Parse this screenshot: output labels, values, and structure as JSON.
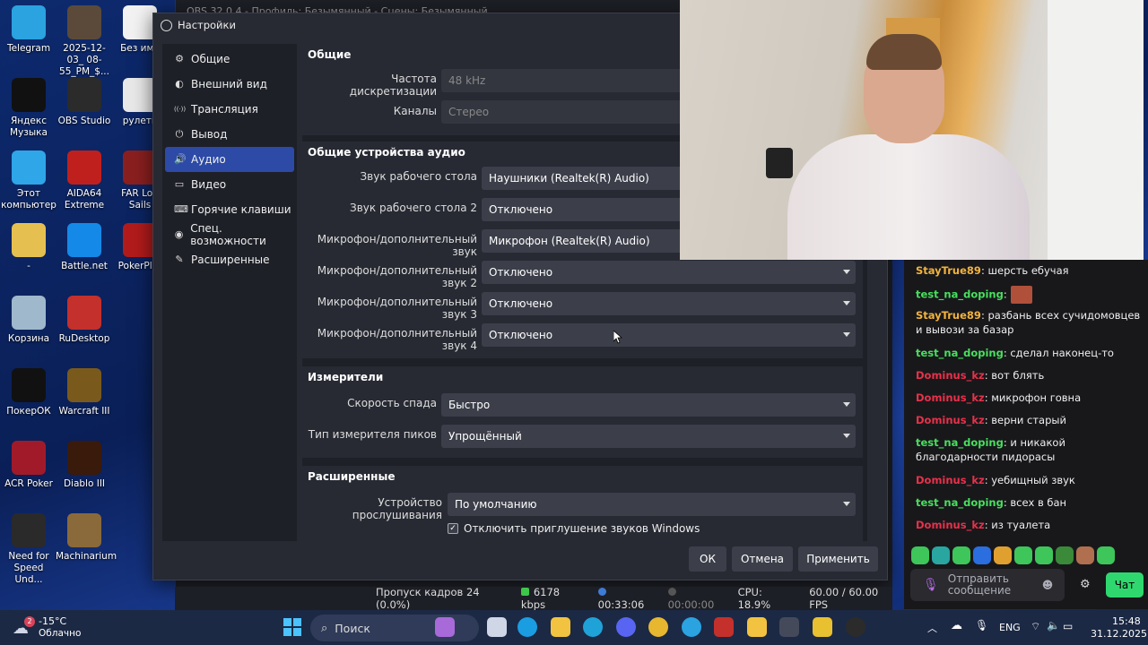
{
  "obs_window_title": "OBS 32.0.4 - Профиль: Безымянный - Сцены: Безымянный",
  "dialog": {
    "title": "Настройки",
    "sidebar": [
      {
        "label": "Общие",
        "icon": "gear-icon",
        "glyph": "⚙"
      },
      {
        "label": "Внешний вид",
        "icon": "appearance-icon",
        "glyph": "◐"
      },
      {
        "label": "Трансляция",
        "icon": "broadcast-icon",
        "glyph": "((·))"
      },
      {
        "label": "Вывод",
        "icon": "output-icon",
        "glyph": "⏻"
      },
      {
        "label": "Аудио",
        "icon": "speaker-icon",
        "glyph": "🔊",
        "active": true
      },
      {
        "label": "Видео",
        "icon": "monitor-icon",
        "glyph": "▭"
      },
      {
        "label": "Горячие клавиши",
        "icon": "keyboard-icon",
        "glyph": "⌨"
      },
      {
        "label": "Спец. возможности",
        "icon": "accessibility-icon",
        "glyph": "◉"
      },
      {
        "label": "Расширенные",
        "icon": "wrench-icon",
        "glyph": "✎"
      }
    ],
    "general": {
      "title": "Общие",
      "sample_rate_label": "Частота дискретизации",
      "sample_rate_value": "48 kHz",
      "channels_label": "Каналы",
      "channels_value": "Стерео"
    },
    "devices": {
      "title": "Общие устройства аудио",
      "rows": [
        {
          "label": "Звук рабочего стола",
          "value": "Наушники (Realtek(R) Audio)"
        },
        {
          "label": "Звук рабочего стола 2",
          "value": "Отключено"
        },
        {
          "label": "Микрофон/дополнительный звук",
          "value": "Микрофон (Realtek(R) Audio)"
        },
        {
          "label": "Микрофон/дополнительный звук 2",
          "value": "Отключено"
        },
        {
          "label": "Микрофон/дополнительный звук 3",
          "value": "Отключено"
        },
        {
          "label": "Микрофон/дополнительный звук 4",
          "value": "Отключено"
        }
      ]
    },
    "meters": {
      "title": "Измерители",
      "decay_label": "Скорость спада",
      "decay_value": "Быстро",
      "peak_label": "Тип измерителя пиков",
      "peak_value": "Упрощённый"
    },
    "advanced": {
      "title": "Расширенные",
      "monitor_label": "Устройство прослушивания",
      "monitor_value": "По умолчанию",
      "ducking_label": "Отключить приглушение звуков Windows",
      "ducking_checked": true
    },
    "buttons": {
      "ok": "ОК",
      "cancel": "Отмена",
      "apply": "Применить"
    }
  },
  "status_bar": {
    "dropped": "Пропуск кадров 24 (0.0%)",
    "bitrate": "6178 kbps",
    "stream_time": "00:33:06",
    "rec_time": "00:00:00",
    "cpu": "CPU: 18.9%",
    "fps": "60.00 / 60.00 FPS"
  },
  "desktop_icons": [
    {
      "label": "Telegram",
      "color": "#2aa3e0"
    },
    {
      "label": "2025-12-03_ 08-55_PM_$...",
      "color": "#5b4a3a"
    },
    {
      "label": "Без име",
      "color": "#f2f2f2"
    },
    {
      "label": "Яндекс Музыка",
      "color": "#111111"
    },
    {
      "label": "OBS Studio",
      "color": "#2b2b2b"
    },
    {
      "label": "рулетк",
      "color": "#e8e8e8"
    },
    {
      "label": "Этот компьютер",
      "color": "#2ea6e8"
    },
    {
      "label": "AIDA64 Extreme",
      "color": "#c0201d"
    },
    {
      "label": "FAR Lon Sails",
      "color": "#8a1f1f"
    },
    {
      "label": "-",
      "color": "#e5c050"
    },
    {
      "label": "Battle.net",
      "color": "#1489e8"
    },
    {
      "label": "PokerPlar",
      "color": "#b11b1b"
    },
    {
      "label": "Корзина",
      "color": "#9fb8cc"
    },
    {
      "label": "RuDesktop",
      "color": "#c4302b"
    },
    {
      "label": "ПокерОК",
      "color": "#111111"
    },
    {
      "label": "Warcraft III",
      "color": "#7a5a1c"
    },
    {
      "label": "ACR Poker",
      "color": "#a11a2a"
    },
    {
      "label": "Diablo III",
      "color": "#3a1a0a"
    },
    {
      "label": "Need for Speed Und...",
      "color": "#2a2a2a"
    },
    {
      "label": "Machinarium",
      "color": "#8a6a3a"
    }
  ],
  "chat": {
    "messages": [
      {
        "user": "StayTrue89",
        "color": "#f2b33d",
        "text": ": шерсть ебучая"
      },
      {
        "user": "test_na_doping",
        "color": "#47e05d",
        "text": ":",
        "emote": true
      },
      {
        "user": "StayTrue89",
        "color": "#f2b33d",
        "text": ": разбань всех сучидомовцев и вывози за базар"
      },
      {
        "user": "test_na_doping",
        "color": "#47e05d",
        "text": ": сделал наконец-то"
      },
      {
        "user": "Dominus_kz",
        "color": "#e8314a",
        "text": ": вот блять"
      },
      {
        "user": "Dominus_kz",
        "color": "#e8314a",
        "text": ": микрофон говна"
      },
      {
        "user": "Dominus_kz",
        "color": "#e8314a",
        "text": ": верни старый"
      },
      {
        "user": "test_na_doping",
        "color": "#47e05d",
        "text": ": и никакой благодарности пидорасы"
      },
      {
        "user": "Dominus_kz",
        "color": "#e8314a",
        "text": ": уебищный звук"
      },
      {
        "user": "test_na_doping",
        "color": "#47e05d",
        "text": ": всех в бан"
      },
      {
        "user": "Dominus_kz",
        "color": "#e8314a",
        "text": ": из туалета"
      }
    ],
    "input_placeholder": "Отправить сообщение",
    "send_label": "Чат"
  },
  "taskbar": {
    "weather_temp": "-15°C",
    "weather_desc": "Облачно",
    "weather_badge": "2",
    "search_placeholder": "Поиск",
    "lang": "ENG",
    "time": "15:48",
    "date": "31.12.2025"
  }
}
